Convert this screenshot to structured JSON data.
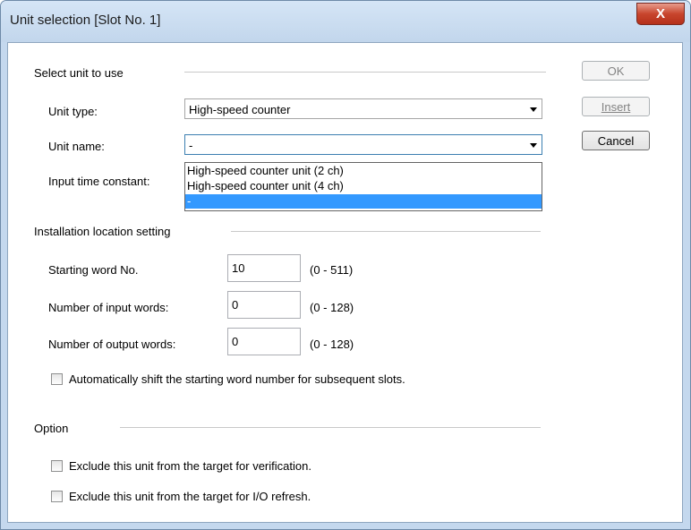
{
  "window": {
    "title": "Unit selection [Slot No. 1]",
    "close_glyph": "X"
  },
  "buttons": {
    "ok": "OK",
    "insert": "Insert",
    "cancel": "Cancel"
  },
  "select_unit": {
    "section_title": "Select unit to use",
    "unit_type_label": "Unit type:",
    "unit_type_value": "High-speed counter",
    "unit_name_label": "Unit name:",
    "unit_name_value": "-",
    "input_time_constant_label": "Input time constant:",
    "unit_name_options": [
      "High-speed counter unit (2 ch)",
      "High-speed counter unit (4 ch)",
      "-"
    ],
    "selected_option": "-"
  },
  "installation": {
    "section_title": "Installation location setting",
    "starting_word_label": "Starting word No.",
    "starting_word_value": "10",
    "starting_word_range": "(0 - 511)",
    "input_words_label": "Number of input words:",
    "input_words_value": "0",
    "input_words_range": "(0 - 128)",
    "output_words_label": "Number of output words:",
    "output_words_value": "0",
    "output_words_range": "(0 - 128)",
    "auto_shift_label": "Automatically shift the starting word number for subsequent slots.",
    "auto_shift_checked": false
  },
  "option": {
    "section_title": "Option",
    "exclude_verification_label": "Exclude this unit from the target for verification.",
    "exclude_verification_checked": false,
    "exclude_refresh_label": "Exclude this unit from the target for I/O refresh.",
    "exclude_refresh_checked": false
  },
  "colors": {
    "selection": "#3399ff",
    "frame": "#c4d8ee",
    "close": "#c8452d"
  }
}
